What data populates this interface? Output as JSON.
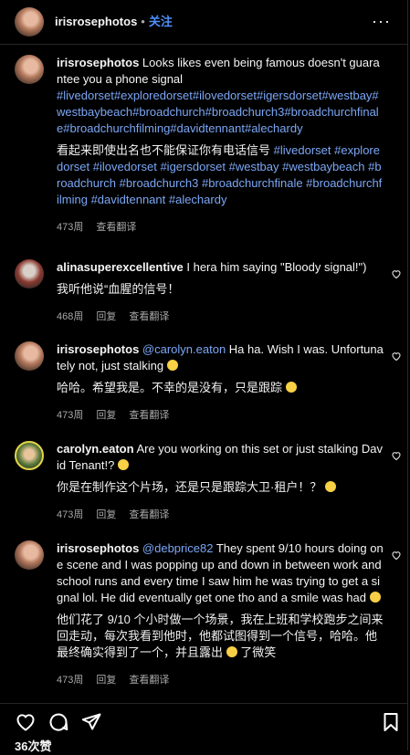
{
  "header": {
    "username": "irisrosephotos",
    "separator": "•",
    "follow_label": "关注",
    "more_label": "···"
  },
  "caption": {
    "username": "irisrosephotos",
    "text": "Looks likes even being famous doesn't guarantee you a phone signal",
    "hashtags": "#livedorset#exploredorset#ilovedorset#igersdorset#westbay#westbaybeach#broadchurch#broadchurch3#broadchurchfinale#broadchurchfilming#davidtennant#alechardy",
    "translation_text": "看起来即使出名也不能保证你有电话信号",
    "translation_tags": "#livedorset #exploredorset #ilovedorset #igersdorset #westbay #westbaybeach #broadchurch #broadchurch3 #broadchurchfinale #broadchurchfilming #davidtennant #alechardy",
    "time": "473周",
    "see_translation": "查看翻译"
  },
  "comments": [
    {
      "username": "alinasuperexcellentive",
      "mention": "",
      "text": "I hera him saying \"Bloody signal!\")",
      "translation": "我听他说“血腥的信号！",
      "time": "468周",
      "reply": "回复",
      "see_translation": "查看翻译"
    },
    {
      "username": "irisrosephotos",
      "mention": "@carolyn.eaton",
      "text": "Ha ha. Wish I was. Unfortunately not, just stalking",
      "translation": "哈哈。希望我是。不幸的是没有，只是跟踪",
      "time": "473周",
      "reply": "回复",
      "see_translation": "查看翻译"
    },
    {
      "username": "carolyn.eaton",
      "mention": "",
      "text": "Are you working on this set or just stalking David Tenant!?",
      "translation": "你是在制作这个片场，还是只是跟踪大卫·租户！？",
      "time": "473周",
      "reply": "回复",
      "see_translation": "查看翻译"
    },
    {
      "username": "irisrosephotos",
      "mention": "@debprice82",
      "text": "They spent 9/10 hours doing one scene and I was popping up and down in between work and school runs and every time I saw him he was trying to get a signal lol. He did eventually get one tho and a smile was had",
      "translation": "他们花了 9/10 个小时做一个场景，我在上班和学校跑步之间来回走动，每次我看到他时，他都试图得到一个信号，哈哈。他最终确实得到了一个，并且露出",
      "translation_tail": "了微笑",
      "time": "473周",
      "reply": "回复",
      "see_translation": "查看翻译"
    }
  ],
  "likes": "36次赞"
}
